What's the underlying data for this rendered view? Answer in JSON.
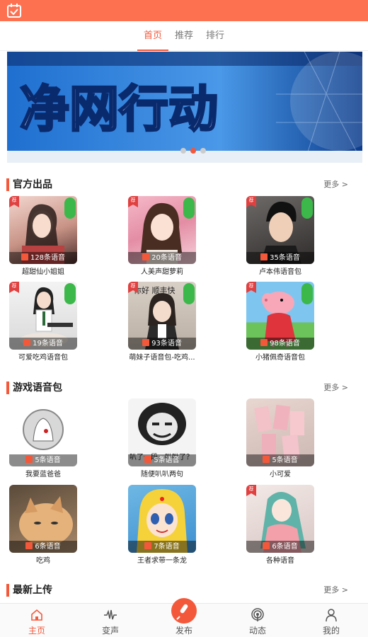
{
  "top_tabs": [
    {
      "label": "首页"
    },
    {
      "label": "推荐"
    },
    {
      "label": "排行"
    }
  ],
  "banner": {
    "text": "净网行动",
    "dots": 3,
    "active_dot": 1
  },
  "sections": {
    "official": {
      "title": "官方出品",
      "more": "更多 >",
      "items": [
        {
          "name": "超甜仙小姐姐",
          "count": "128条语音"
        },
        {
          "name": "人美声甜萝莉",
          "count": "20条语音"
        },
        {
          "name": "卢本伟语音包",
          "count": "35条语音"
        },
        {
          "name": "可爱吃鸡语音包",
          "count": "19条语音"
        },
        {
          "name": "萌妹子语音包-吃鸡...",
          "count": "93条语音"
        },
        {
          "name": "小猪佩奇语音包",
          "count": "98条语音"
        }
      ]
    },
    "game": {
      "title": "游戏语音包",
      "more": "更多 >",
      "items": [
        {
          "name": "我要蓝爸爸",
          "count": "5条语音"
        },
        {
          "name": "随便叭叭两句",
          "count": "5条语音"
        },
        {
          "name": "小可爱",
          "count": "5条语音"
        },
        {
          "name": "吃鸡",
          "count": "6条语音"
        },
        {
          "name": "王者求带一条龙",
          "count": "7条语音"
        },
        {
          "name": "各种语音",
          "count": "6条语音"
        }
      ]
    },
    "latest": {
      "title": "最新上传",
      "more": "更多 >"
    }
  },
  "bottom_nav": [
    {
      "label": "主页"
    },
    {
      "label": "变声"
    },
    {
      "label": "发布"
    },
    {
      "label": "动态"
    },
    {
      "label": "我的"
    }
  ],
  "colors": {
    "accent": "#f4583a",
    "status_bar": "#fd7150"
  }
}
